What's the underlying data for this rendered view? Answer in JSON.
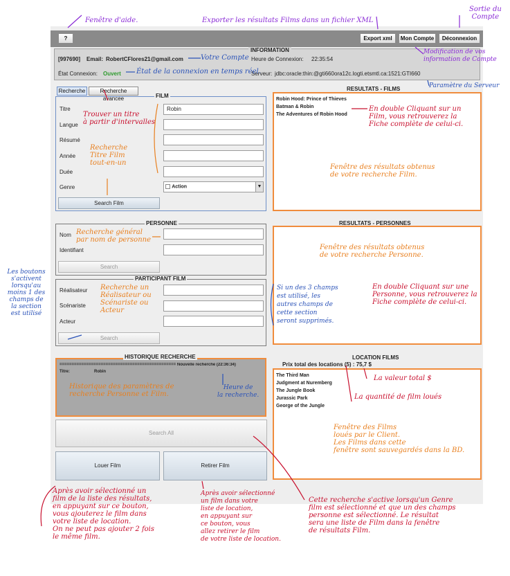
{
  "toolbar": {
    "help_label": "?",
    "export_label": "Export xml",
    "account_label": "Mon Compte",
    "logout_label": "Déconnexion"
  },
  "info": {
    "title": "INFORMATION",
    "id": "[997690]",
    "email_label": "Email:",
    "email": "RobertCFlores21@gmail.com",
    "conn_state_label": "État Connexion:",
    "conn_state": "Ouvert",
    "conn_time_label": "Heure de Connexion:",
    "conn_time": "22:35:54",
    "server_label": "Serveur:",
    "server": "jdbc:oracle:thin:@gti660ora12c.logti.etsmtl.ca:1521:GTI660"
  },
  "tabs": [
    "Recherche",
    "Recherche avancée"
  ],
  "film": {
    "title": "FILM",
    "labels": [
      "Titre",
      "Langue",
      "Résumé",
      "Année",
      "Duée",
      "Genre"
    ],
    "titre_value": "Robin",
    "genre_value": "Action",
    "search_label": "Search Film"
  },
  "personne": {
    "title": "PERSONNE",
    "labels": [
      "Nom",
      "Identifiant"
    ],
    "search_label": "Search"
  },
  "participant": {
    "title": "PARTICIPANT  FILM",
    "labels": [
      "Réalisateur",
      "Scénariste",
      "Acteur"
    ],
    "search_label": "Search"
  },
  "historique": {
    "title": "HISTORIQUE RECHERCHE",
    "header": "================================================ Nouvelle recherche (22:36:34)",
    "titre_label": "Titre:",
    "titre_value": "Robin"
  },
  "search_all_label": "Search All",
  "louer_label": "Louer Film",
  "retirer_label": "Retirer Film",
  "results_films": {
    "title": "RESULTATS - FILMS",
    "items": [
      "Robin Hood: Prince of Thieves",
      "Batman & Robin",
      "The Adventures of Robin Hood"
    ]
  },
  "results_personnes": {
    "title": "RESULTATS - PERSONNES"
  },
  "location": {
    "title": "LOCATION FILMS",
    "total": "Prix total des locations (5) :  75,7 $",
    "items": [
      "The Third Man",
      "Judgment at Nuremberg",
      "The Jungle Book",
      "Jurassic Park",
      "George of the Jungle"
    ]
  },
  "annotations": {
    "aide": "Fenêtre d'aide.",
    "export": "Exporter les résultats Films dans un fichier XML",
    "sortie": "Sortie du\nCompte",
    "modif": "Modification de vos\ninformation de Compte",
    "votre_compte": "Votre Compte",
    "etat": "État de la connexion en temps réel.",
    "param_serveur": "Paramètre du Serveur",
    "trouver": "Trouver un titre\nà partir d'intervalles",
    "recherche_titre": "Recherche\nTitre Film\ntout-en-un",
    "double_film": "En double Cliquant sur un\nFilm, vous retrouverez la\nFiche complète de celui-ci.",
    "fenetre_films": "Fenêtre des résultats obtenus\nde votre recherche Film.",
    "generale": "Recherche général\npar nom de personne",
    "fenetre_personne": "Fenêtre des résultats obtenus\nde votre recherche Personne.",
    "double_personne": "En double Cliquant sur une\nPersonne, vous retrouverez la\nFiche complète de celui-ci.",
    "boutons": "Les boutons\ns'activent\nlorsqu'au\nmoins 1 des\nchamps de\nla section\nest utilisé",
    "recherche_real": "Recherche un\nRéalisateur ou\nScénariste ou\nActeur",
    "trois_champs": "Si un des 3 champs\nest utilisé, les\nautres champs de\ncette section\nseront supprimés.",
    "historique_param": "Historique des paramètres de\nrecherche Personne et Film.",
    "heure": "Heure de\nla recherche.",
    "valeur_total": "La valeur total $",
    "quantite": "La quantité de film loués",
    "fenetre_loues": "Fenêtre des Films\nloués par le Client.\nLes Films dans cette\nfenêtre sont sauvegardés dans la BD.",
    "louer_note": "Après avoir sélectionné un\nfilm de la liste des résultats,\nen appuyant sur ce bouton,\nvous ajouterez le film dans\nvotre liste de location.\nOn ne peut pas ajouter 2 fois\nle même film.",
    "retirer_note": "Après avoir sélectionné\nun film dans votre\nliste de location,\nen appuyant sur\nce bouton, vous\nallez retirer le film\nde votre liste de location.",
    "search_all_note": "Cette recherche s'active lorsqu'un Genre\nfilm est sélectionné et que un des champs\npersonne est sélectionné. Le résultat\nsera une liste de Film dans la fenêtre\nde résultats Film."
  },
  "colors": {
    "red": "#c8102e",
    "blue": "#2a52b8",
    "orange": "#e87f1e",
    "purple": "#8a2bd6",
    "green": "#2e9b2e"
  }
}
